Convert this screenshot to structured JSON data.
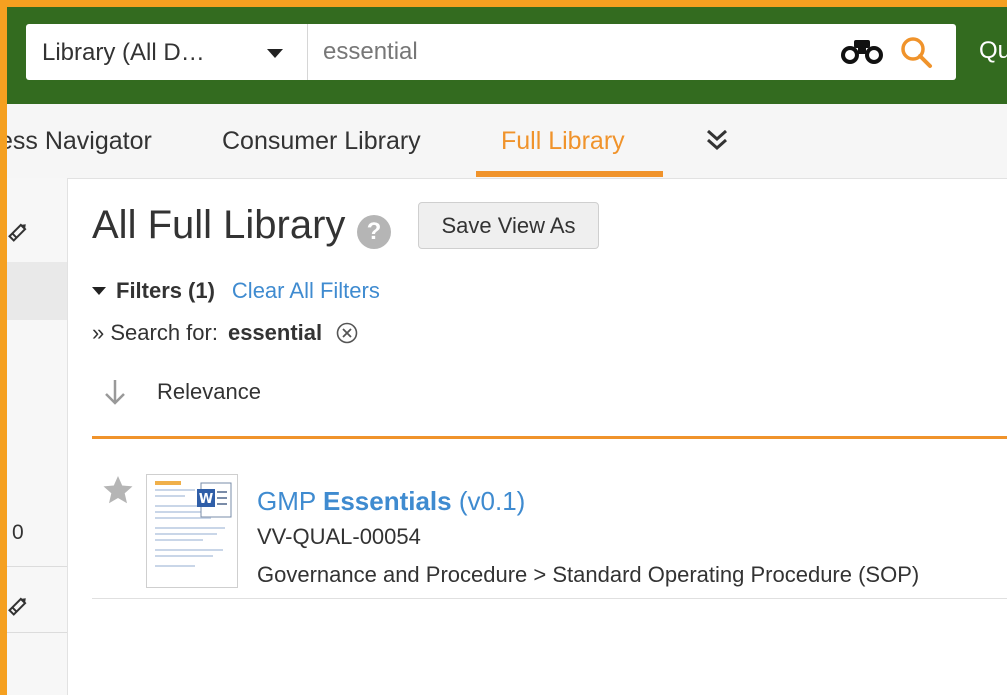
{
  "header": {
    "scope_label": "Library (All D…",
    "search_value": "essential",
    "overflow_text": "Qu"
  },
  "tabs": [
    {
      "label": "ess Navigator"
    },
    {
      "label": "Consumer Library"
    },
    {
      "label": "Full Library",
      "active": true
    }
  ],
  "sidebar": {
    "count": "0"
  },
  "main": {
    "title": "All Full Library",
    "help_glyph": "?",
    "save_view_label": "Save View As",
    "filters_label": "Filters",
    "filters_count": "(1)",
    "clear_filters_label": "Clear All Filters",
    "search_for_prefix": "» Search for:",
    "search_for_term": "essential",
    "sort_label": "Relevance"
  },
  "results": [
    {
      "title_prefix": "GMP ",
      "title_highlight": "Essentials",
      "title_version": " (v0.1)",
      "doc_number": "VV-QUAL-00054",
      "classification": "Governance and Procedure > Standard Operating Procedure (SOP)"
    }
  ],
  "icons": {
    "scope": "caret-down-icon",
    "binoculars": "binoculars-icon",
    "search": "search-icon",
    "more_tabs": "double-chevron-down-icon",
    "help": "help-icon",
    "remove": "remove-circle-icon",
    "sort": "arrow-down-icon",
    "star": "star-icon",
    "pencil": "pencil-icon"
  },
  "colors": {
    "frame_orange": "#f5a020",
    "header_green": "#336b1f",
    "accent_orange": "#f0932b",
    "link_blue": "#3f8bd0"
  }
}
